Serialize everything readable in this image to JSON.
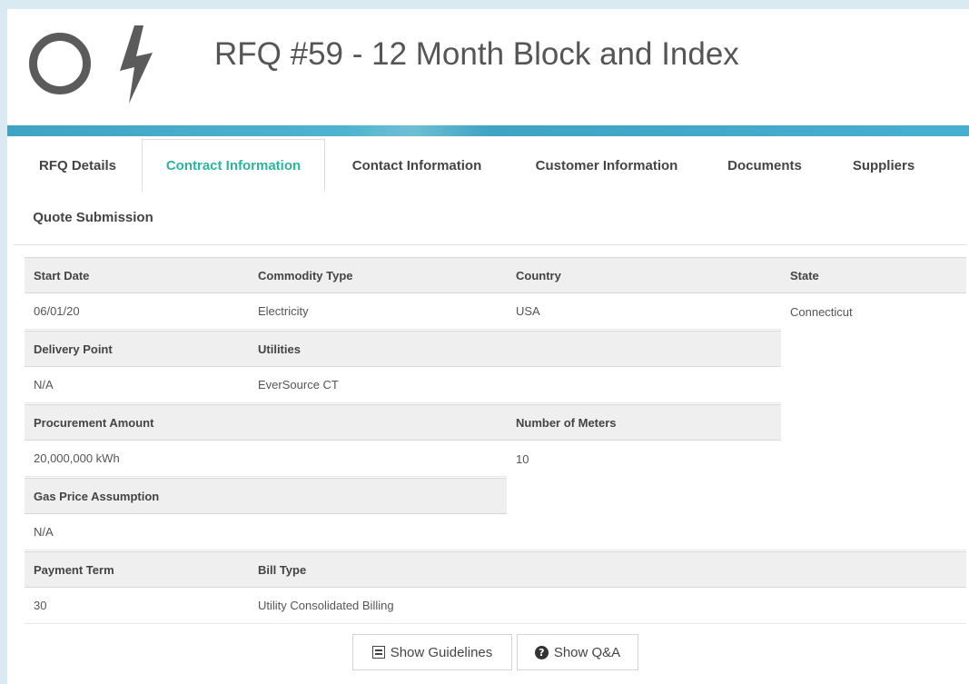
{
  "header": {
    "title": "RFQ #59 - 12 Month Block and Index",
    "logo_icons": [
      "ring-icon",
      "bolt-icon"
    ]
  },
  "tabs": [
    {
      "label": "RFQ Details"
    },
    {
      "label": "Contract Information",
      "active": true
    },
    {
      "label": "Contact Information"
    },
    {
      "label": "Customer Information"
    },
    {
      "label": "Documents"
    },
    {
      "label": "Suppliers"
    },
    {
      "label": "Quote Submission"
    }
  ],
  "fields": {
    "start_date": {
      "label": "Start Date",
      "value": "06/01/20"
    },
    "commodity_type": {
      "label": "Commodity Type",
      "value": "Electricity"
    },
    "country": {
      "label": "Country",
      "value": "USA"
    },
    "state": {
      "label": "State",
      "value": "Connecticut"
    },
    "delivery_point": {
      "label": "Delivery Point",
      "value": "N/A"
    },
    "utilities": {
      "label": "Utilities",
      "value": "EverSource CT"
    },
    "procurement_amount": {
      "label": "Procurement Amount",
      "value": "20,000,000 kWh"
    },
    "number_of_meters": {
      "label": "Number of Meters",
      "value": "10"
    },
    "gas_price_assumption": {
      "label": "Gas Price Assumption",
      "value": "N/A"
    },
    "payment_term": {
      "label": "Payment Term",
      "value": "30"
    },
    "bill_type": {
      "label": "Bill Type",
      "value": "Utility Consolidated Billing"
    }
  },
  "buttons": {
    "show_guidelines": "Show Guidelines",
    "show_qa": "Show Q&A"
  },
  "colors": {
    "active_tab": "#2bb4a0",
    "banner": "#3fa4c4",
    "background": "#d9eaf3"
  }
}
